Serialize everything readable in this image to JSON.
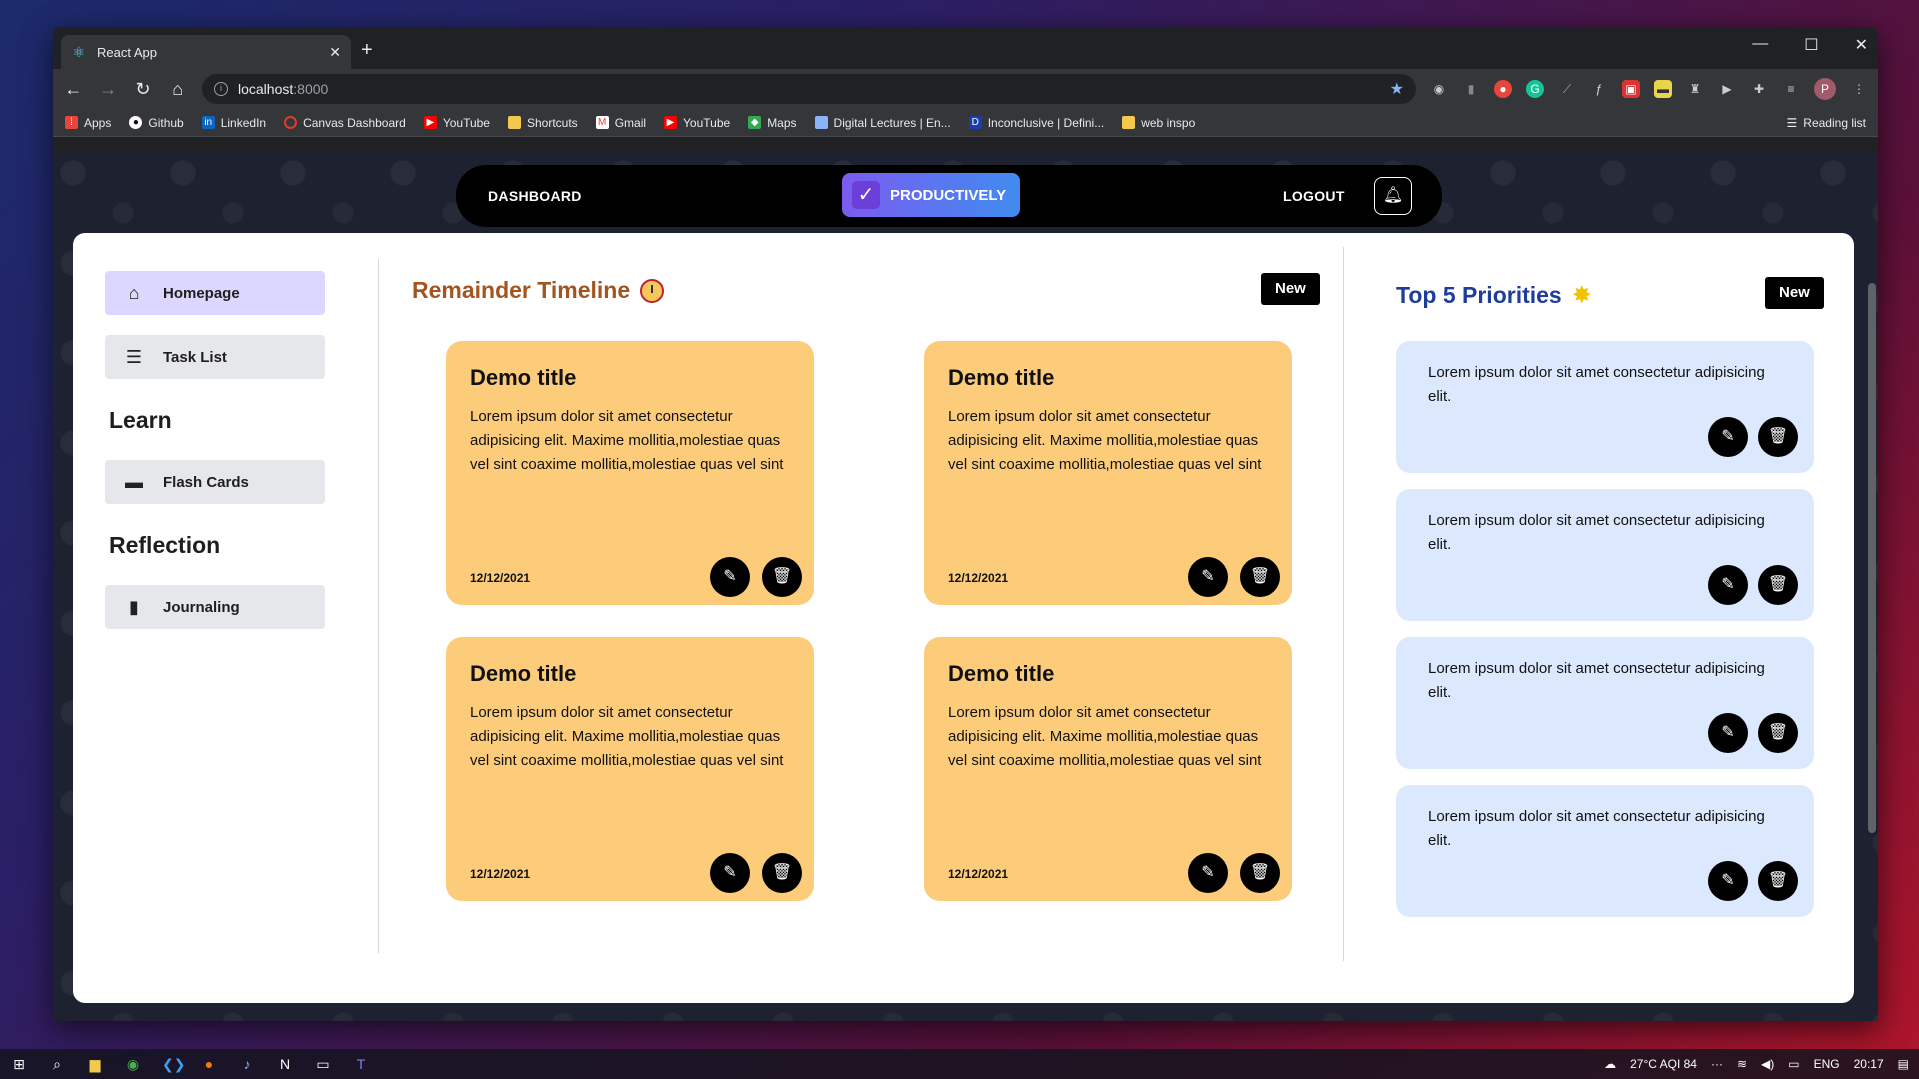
{
  "browser": {
    "tab_title": "React App",
    "new_tab": "+",
    "url_host": "localhost",
    "url_port": ":8000",
    "window_controls": [
      "—",
      "☐",
      "✕"
    ],
    "avatar_letter": "P",
    "reading_list": "Reading list",
    "bookmarks": [
      {
        "label": "Apps",
        "icon": "apps-grid-icon",
        "color": "#e8453c"
      },
      {
        "label": "Github",
        "icon": "github-icon",
        "color": "#ffffff"
      },
      {
        "label": "LinkedIn",
        "icon": "linkedin-icon",
        "color": "#0a66c2"
      },
      {
        "label": "Canvas Dashboard",
        "icon": "canvas-icon",
        "color": "#e13a2e"
      },
      {
        "label": "YouTube",
        "icon": "youtube-icon",
        "color": "#ff0000"
      },
      {
        "label": "Shortcuts",
        "icon": "folder-icon",
        "color": "#f2c94c"
      },
      {
        "label": "Gmail",
        "icon": "gmail-icon",
        "color": "#ea4335"
      },
      {
        "label": "YouTube",
        "icon": "youtube-icon",
        "color": "#ff0000"
      },
      {
        "label": "Maps",
        "icon": "maps-icon",
        "color": "#34a853"
      },
      {
        "label": "Digital Lectures | En...",
        "icon": "page-icon",
        "color": "#8ab4f8"
      },
      {
        "label": "Inconclusive | Defini...",
        "icon": "dictionary-icon",
        "color": "#1a3fa8"
      },
      {
        "label": "web inspo",
        "icon": "folder-icon",
        "color": "#f2c94c"
      }
    ]
  },
  "nav": {
    "dashboard": "DASHBOARD",
    "brand": "PRODUCTIVELY",
    "logout": "LOGOUT"
  },
  "sidebar": {
    "homepage": "Homepage",
    "task_list": "Task List",
    "learn_heading": "Learn",
    "flash_cards": "Flash Cards",
    "reflection_heading": "Reflection",
    "journaling": "Journaling"
  },
  "timeline": {
    "title": "Remainder Timeline",
    "new_label": "New",
    "cards": [
      {
        "title": "Demo title",
        "body": "Lorem ipsum dolor sit amet consectetur adipisicing elit. Maxime mollitia,molestiae quas vel sint coaxime mollitia,molestiae quas vel sint",
        "date": "12/12/2021"
      },
      {
        "title": "Demo title",
        "body": "Lorem ipsum dolor sit amet consectetur adipisicing elit. Maxime mollitia,molestiae quas vel sint coaxime mollitia,molestiae quas vel sint",
        "date": "12/12/2021"
      },
      {
        "title": "Demo title",
        "body": "Lorem ipsum dolor sit amet consectetur adipisicing elit. Maxime mollitia,molestiae quas vel sint coaxime mollitia,molestiae quas vel sint",
        "date": "12/12/2021"
      },
      {
        "title": "Demo title",
        "body": "Lorem ipsum dolor sit amet consectetur adipisicing elit. Maxime mollitia,molestiae quas vel sint coaxime mollitia,molestiae quas vel sint",
        "date": "12/12/2021"
      }
    ]
  },
  "priorities": {
    "title": "Top 5 Priorities",
    "new_label": "New",
    "items": [
      "Lorem ipsum dolor sit amet consectetur adipisicing elit.",
      "Lorem ipsum dolor sit amet consectetur adipisicing elit.",
      "Lorem ipsum dolor sit amet consectetur adipisicing elit.",
      "Lorem ipsum dolor sit amet consectetur adipisicing elit."
    ]
  },
  "taskbar": {
    "weather": "27°C  AQI 84",
    "overflow": "···",
    "lang": "ENG",
    "time": "20:17"
  },
  "colors": {
    "card_yellow": "#fdcc7b",
    "card_blue": "#dbe8fd",
    "timeline_title": "#a3541f",
    "priorities_title": "#1f3d9a",
    "active_nav": "#dcd7ff"
  }
}
